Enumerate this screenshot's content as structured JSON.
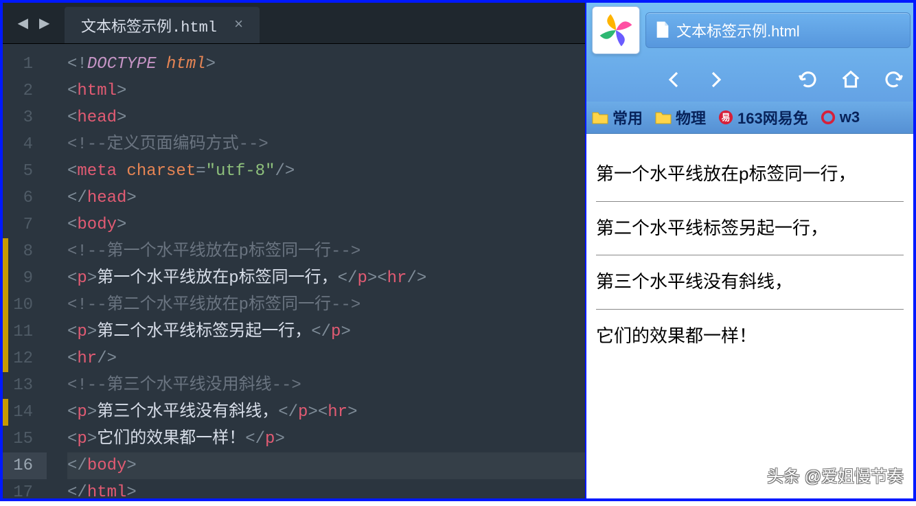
{
  "editor": {
    "tab_title": "文本标签示例.html",
    "code": [
      [
        {
          "t": "<!",
          "c": "pun"
        },
        {
          "t": "DOCTYPE",
          "c": "kw"
        },
        {
          "t": " ",
          "c": "pun"
        },
        {
          "t": "html",
          "c": "kw2"
        },
        {
          "t": ">",
          "c": "pun"
        }
      ],
      [
        {
          "t": "<",
          "c": "pun"
        },
        {
          "t": "html",
          "c": "tag"
        },
        {
          "t": ">",
          "c": "pun"
        }
      ],
      [
        {
          "t": "<",
          "c": "pun"
        },
        {
          "t": "head",
          "c": "tag"
        },
        {
          "t": ">",
          "c": "pun"
        }
      ],
      [
        {
          "t": "    ",
          "c": "pun"
        },
        {
          "t": "<!--",
          "c": "cmt"
        },
        {
          "t": "定义页面编码方式",
          "c": "cmt"
        },
        {
          "t": "-->",
          "c": "cmt"
        }
      ],
      [
        {
          "t": "    ",
          "c": "pun"
        },
        {
          "t": "<",
          "c": "pun"
        },
        {
          "t": "meta",
          "c": "tag"
        },
        {
          "t": " ",
          "c": "pun"
        },
        {
          "t": "charset",
          "c": "attr"
        },
        {
          "t": "=",
          "c": "pun"
        },
        {
          "t": "\"utf-8\"",
          "c": "str"
        },
        {
          "t": "/>",
          "c": "pun"
        }
      ],
      [
        {
          "t": "</",
          "c": "pun"
        },
        {
          "t": "head",
          "c": "tag"
        },
        {
          "t": ">",
          "c": "pun"
        }
      ],
      [
        {
          "t": "<",
          "c": "pun"
        },
        {
          "t": "body",
          "c": "tag"
        },
        {
          "t": ">",
          "c": "pun"
        }
      ],
      [
        {
          "t": "    ",
          "c": "pun"
        },
        {
          "t": "<!--",
          "c": "cmt"
        },
        {
          "t": "第一个水平线放在p标签同一行",
          "c": "cmt"
        },
        {
          "t": "-->",
          "c": "cmt"
        }
      ],
      [
        {
          "t": "    ",
          "c": "pun"
        },
        {
          "t": "<",
          "c": "pun"
        },
        {
          "t": "p",
          "c": "tag"
        },
        {
          "t": ">",
          "c": "pun"
        },
        {
          "t": "第一个水平线放在p标签同一行，",
          "c": "txt"
        },
        {
          "t": "</",
          "c": "pun"
        },
        {
          "t": "p",
          "c": "tag"
        },
        {
          "t": "><",
          "c": "pun"
        },
        {
          "t": "hr",
          "c": "tag"
        },
        {
          "t": "/>",
          "c": "pun"
        }
      ],
      [
        {
          "t": "    ",
          "c": "pun"
        },
        {
          "t": "<!--",
          "c": "cmt"
        },
        {
          "t": "第二个水平线放在p标签同一行",
          "c": "cmt"
        },
        {
          "t": "-->",
          "c": "cmt"
        }
      ],
      [
        {
          "t": "    ",
          "c": "pun"
        },
        {
          "t": "<",
          "c": "pun"
        },
        {
          "t": "p",
          "c": "tag"
        },
        {
          "t": ">",
          "c": "pun"
        },
        {
          "t": "第二个水平线标签另起一行，",
          "c": "txt"
        },
        {
          "t": "</",
          "c": "pun"
        },
        {
          "t": "p",
          "c": "tag"
        },
        {
          "t": ">",
          "c": "pun"
        }
      ],
      [
        {
          "t": "    ",
          "c": "pun"
        },
        {
          "t": "<",
          "c": "pun"
        },
        {
          "t": "hr",
          "c": "tag"
        },
        {
          "t": "/>",
          "c": "pun"
        }
      ],
      [
        {
          "t": "    ",
          "c": "pun"
        },
        {
          "t": "<!--",
          "c": "cmt"
        },
        {
          "t": "第三个水平线没用斜线",
          "c": "cmt"
        },
        {
          "t": "-->",
          "c": "cmt"
        }
      ],
      [
        {
          "t": "    ",
          "c": "pun"
        },
        {
          "t": "<",
          "c": "pun"
        },
        {
          "t": "p",
          "c": "tag"
        },
        {
          "t": ">",
          "c": "pun"
        },
        {
          "t": "第三个水平线没有斜线，",
          "c": "txt"
        },
        {
          "t": "</",
          "c": "pun"
        },
        {
          "t": "p",
          "c": "tag"
        },
        {
          "t": "><",
          "c": "pun"
        },
        {
          "t": "hr",
          "c": "tag"
        },
        {
          "t": ">",
          "c": "pun"
        }
      ],
      [
        {
          "t": "    ",
          "c": "pun"
        },
        {
          "t": "<",
          "c": "pun"
        },
        {
          "t": "p",
          "c": "tag"
        },
        {
          "t": ">",
          "c": "pun"
        },
        {
          "t": "它们的效果都一样！",
          "c": "txt"
        },
        {
          "t": "</",
          "c": "pun"
        },
        {
          "t": "p",
          "c": "tag"
        },
        {
          "t": ">",
          "c": "pun"
        }
      ],
      [
        {
          "t": "</",
          "c": "pun"
        },
        {
          "t": "body",
          "c": "tag"
        },
        {
          "t": ">",
          "c": "pun"
        }
      ],
      [
        {
          "t": "</",
          "c": "pun"
        },
        {
          "t": "html",
          "c": "tag"
        },
        {
          "t": ">",
          "c": "pun"
        }
      ]
    ],
    "highlight_line": 16,
    "change_marks": [
      8,
      9,
      10,
      11,
      12,
      14
    ]
  },
  "browser": {
    "tab_title": "文本标签示例.html",
    "bookmarks": [
      {
        "icon": "folder",
        "label": "常用"
      },
      {
        "icon": "folder",
        "label": "物理"
      },
      {
        "icon": "red",
        "label": "163网易免"
      },
      {
        "icon": "ring",
        "label": "w3"
      }
    ],
    "page": {
      "p1": "第一个水平线放在p标签同一行，",
      "p2": "第二个水平线标签另起一行，",
      "p3": "第三个水平线没有斜线，",
      "p4": "它们的效果都一样！"
    },
    "watermark": "头条 @爱姐慢节奏"
  }
}
